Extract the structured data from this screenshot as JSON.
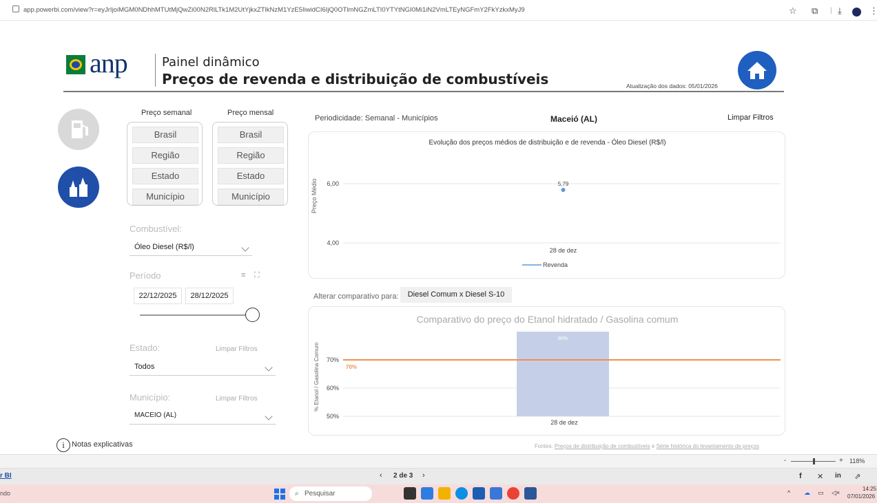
{
  "browser": {
    "url": "app.powerbi.com/view?r=eyJrIjoiMGM0NDhhMTUtMjQwZi00N2RlLTk1M2UtYjkxZTlkNzM1YzE5IiwidCI6IjQ0OTlmNGZmLTI0YTYtNGI0Mi1iN2VmLTEyNGFmY2FkYzkxMyJ9",
    "icons": [
      "star-icon",
      "extension-icon",
      "download-icon",
      "profile-icon",
      "menu-icon"
    ]
  },
  "header": {
    "logo_text": "anp",
    "subtitle": "Painel dinâmico",
    "title": "Preços de revenda e distribuição de combustíveis",
    "update": "Atualização dos dados: 05/01/2026"
  },
  "price_columns": {
    "weekly_label": "Preço semanal",
    "monthly_label": "Preço mensal",
    "options": [
      "Brasil",
      "Região",
      "Estado",
      "Município"
    ]
  },
  "filters": {
    "fuel_label": "Combustível:",
    "fuel_value": "Óleo Diesel (R$/l)",
    "period_label": "Período",
    "date_start": "22/12/2025",
    "date_end": "28/12/2025",
    "state_label": "Estado:",
    "state_clear": "Limpar Filtros",
    "state_value": "Todos",
    "city_label": "Município:",
    "city_clear": "Limpar Filtros",
    "city_value": "MACEIO (AL)",
    "notes": "Notas explicativas"
  },
  "top_bar": {
    "periodicity": "Periodicidade: Semanal - Municípios",
    "location": "Maceió (AL)",
    "clear": "Limpar Filtros"
  },
  "chart_data": [
    {
      "type": "scatter",
      "title": "Evolução dos preços médios de distribuição e de revenda - Óleo Diesel (R$/l)",
      "ylabel": "Preço Médio",
      "y_ticks": [
        "6,00",
        "4,00"
      ],
      "ylim": [
        4,
        6
      ],
      "categories": [
        "28 de dez"
      ],
      "series": [
        {
          "name": "Revenda",
          "values": [
            5.79
          ],
          "labels": [
            "5,79"
          ],
          "color": "#5b9bd5"
        }
      ],
      "legend_position": "bottom"
    },
    {
      "type": "bar",
      "title": "Comparativo do preço do Etanol hidratado / Gasolina comum",
      "ylabel": "% Etanol / Gasolina Comum",
      "y_ticks": [
        "70%",
        "60%",
        "50%"
      ],
      "ylim": [
        50,
        80
      ],
      "categories": [
        "28 de dez"
      ],
      "values": [
        80
      ],
      "value_labels": [
        "80%"
      ],
      "reference_line": {
        "value": 70,
        "label": "70%",
        "color": "#f28e50"
      },
      "bar_color": "#c5d0e8"
    }
  ],
  "comparison": {
    "label": "Alterar comparativo para:",
    "button": "Diesel Comum x Diesel S-10"
  },
  "sources": {
    "prefix": "Fontes:",
    "link1": "Preços de distribuição de combustíveis",
    "sep": "e",
    "link2": "Série histórica do levantamento de preços"
  },
  "pbi": {
    "zoom": "118%",
    "brand": "r BI",
    "page": "2 de 3"
  },
  "taskbar": {
    "left": "ndo",
    "search": "Pesquisar",
    "time": "14:25",
    "date": "07/01/2026"
  }
}
